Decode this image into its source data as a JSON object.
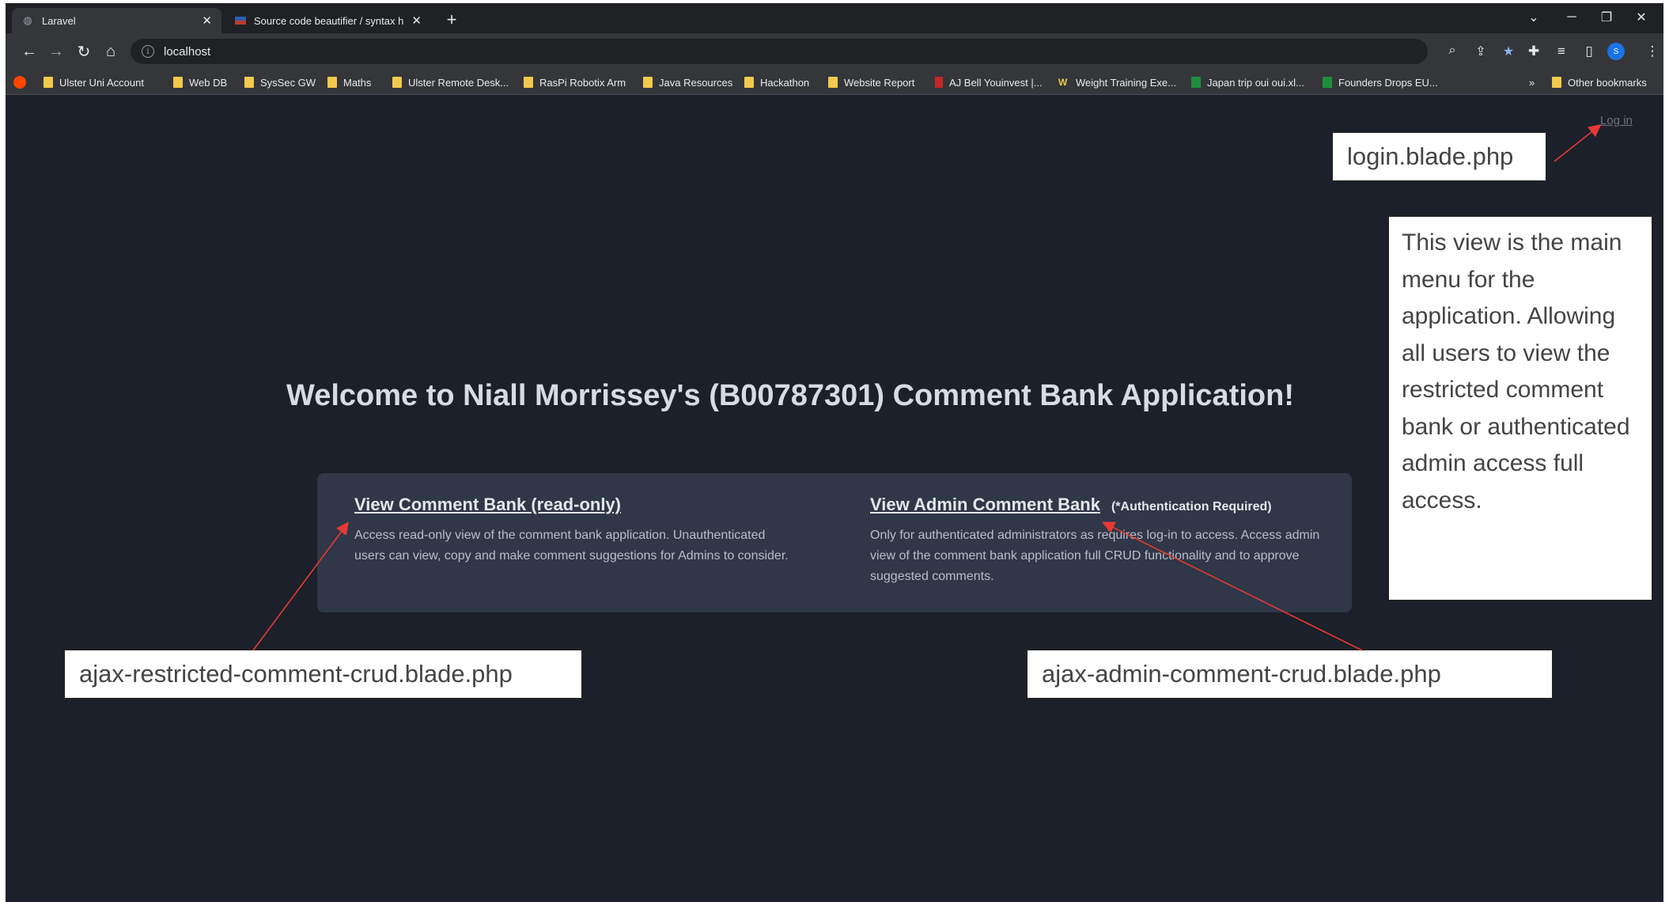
{
  "browser": {
    "tabs": [
      {
        "title": "Laravel",
        "active": true
      },
      {
        "title": "Source code beautifier / syntax h",
        "active": false
      }
    ],
    "address": "localhost",
    "bookmarks": [
      {
        "label": "Ulster Uni Account",
        "icon": "folder-icon"
      },
      {
        "label": "Web DB",
        "icon": "folder-icon"
      },
      {
        "label": "SysSec GW",
        "icon": "folder-icon"
      },
      {
        "label": "Maths",
        "icon": "folder-icon"
      },
      {
        "label": "Ulster Remote Desk...",
        "icon": "folder-icon"
      },
      {
        "label": "RasPi Robotix Arm",
        "icon": "folder-icon"
      },
      {
        "label": "Java Resources",
        "icon": "folder-icon"
      },
      {
        "label": "Hackathon",
        "icon": "folder-icon"
      },
      {
        "label": "Website Report",
        "icon": "folder-icon"
      },
      {
        "label": "AJ Bell Youinvest |...",
        "icon": "ajbell-icon"
      },
      {
        "label": "Weight Training Exe...",
        "icon": "w-icon"
      },
      {
        "label": "Japan trip oui oui.xl...",
        "icon": "sheets-icon"
      },
      {
        "label": "Founders Drops EU...",
        "icon": "sheets-icon"
      }
    ],
    "overflow_label": "»",
    "other_bookmarks": "Other bookmarks",
    "profile_initial": "S"
  },
  "page": {
    "login_label": "Log in",
    "welcome_title": "Welcome to Niall Morrissey's (B00787301) Comment Bank Application!",
    "readonly_link": "View Comment Bank (read-only)",
    "readonly_desc": "Access read-only view of the comment bank application. Unauthenticated users can view, copy and make comment suggestions for Admins to consider.",
    "admin_link": "View Admin Comment Bank",
    "admin_note": "(*Authentication Required)",
    "admin_desc": "Only for authenticated administrators as requires log-in to access. Access admin view of the comment bank application full CRUD functionality and to approve suggested comments."
  },
  "annotations": {
    "login": "login.blade.php",
    "main_menu": "This view is the main menu for the application. Allowing all users to view the restricted comment bank or authenticated admin access full access.",
    "restricted": "ajax-restricted-comment-crud.blade.php",
    "admin": "ajax-admin-comment-crud.blade.php",
    "arrow_color": "#e53935"
  },
  "colors": {
    "page_bg": "#1c202a",
    "card_bg": "#2f3748",
    "chrome_dark": "#202124",
    "chrome_mid": "#35363a"
  }
}
